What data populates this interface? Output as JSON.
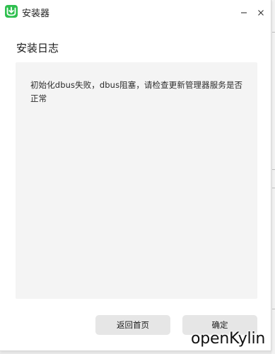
{
  "window": {
    "title": "安装器",
    "minimize_label": "–",
    "close_label": "×"
  },
  "content": {
    "heading": "安装日志",
    "log_message": "初始化dbus失败，dbus阻塞，请检查更新管理器服务是否正常"
  },
  "actions": {
    "home_label": "返回首页",
    "ok_label": "确定"
  },
  "watermark": {
    "text": "openKylin"
  },
  "colors": {
    "app_icon": "#2fbf4f",
    "panel_bg": "#f4f4f4",
    "button_bg": "#e6e6e6"
  },
  "icons": {
    "app": "installer-download-icon",
    "minimize": "minimize-icon",
    "close": "close-icon"
  }
}
